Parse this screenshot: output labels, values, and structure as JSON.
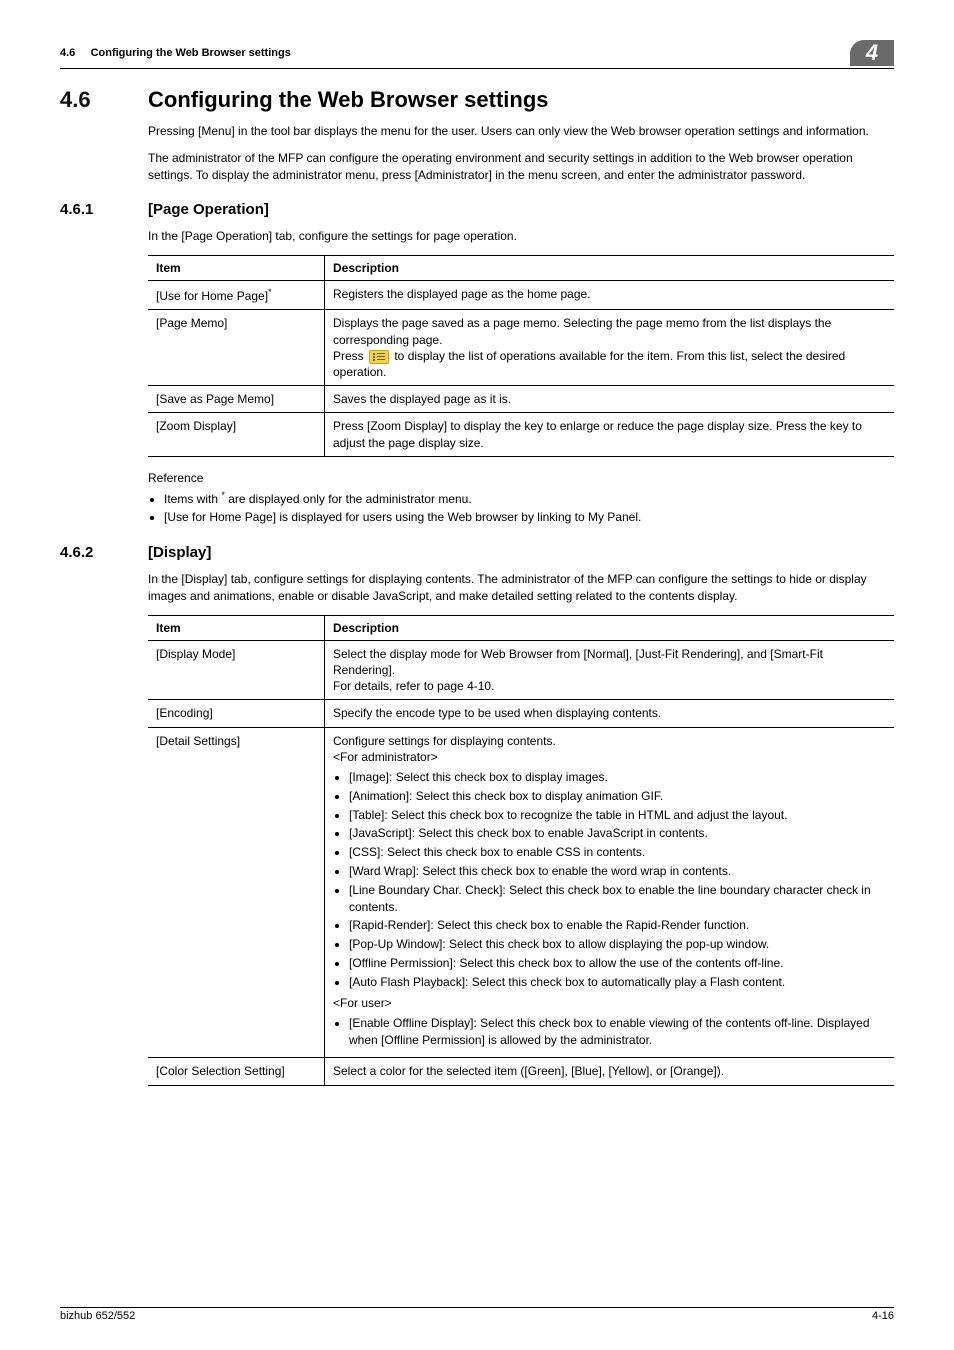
{
  "header": {
    "section_no_top": "4.6",
    "section_title_top": "Configuring the Web Browser settings",
    "badge": "4"
  },
  "sec_4_6": {
    "num": "4.6",
    "title": "Configuring the Web Browser settings",
    "para1": "Pressing [Menu] in the tool bar displays the menu for the user. Users can only view the Web browser operation settings and information.",
    "para2": "The administrator of the MFP can configure the operating environment and security settings in addition to the Web browser operation settings. To display the administrator menu, press [Administrator] in the menu screen, and enter the administrator password."
  },
  "sec_4_6_1": {
    "num": "4.6.1",
    "title": "[Page Operation]",
    "intro": "In the [Page Operation] tab, configure the settings for page operation.",
    "col_item": "Item",
    "col_desc": "Description",
    "rows": [
      {
        "item": "[Use for Home Page]",
        "star": "*",
        "desc": "Registers the displayed page as the home page."
      },
      {
        "item": "[Page Memo]",
        "desc_pre": "Displays the page saved as a page memo. Selecting the page memo from the list displays the corresponding page.\nPress ",
        "desc_post": " to display the list of operations available for the item. From this list, select the desired operation."
      },
      {
        "item": "[Save as Page Memo]",
        "desc": "Saves the displayed page as it is."
      },
      {
        "item": "[Zoom Display]",
        "desc": "Press [Zoom Display] to display the key to enlarge or reduce the page display size. Press the key to adjust the page display size."
      }
    ],
    "reference_label": "Reference",
    "ref1_pre": "Items with ",
    "ref1_star": "*",
    "ref1_post": " are displayed only for the administrator menu.",
    "ref2": "[Use for Home Page] is displayed for users using the Web browser by linking to My Panel."
  },
  "sec_4_6_2": {
    "num": "4.6.2",
    "title": "[Display]",
    "intro": "In the [Display] tab, configure settings for displaying contents. The administrator of the MFP can configure the settings to hide or display images and animations, enable or disable JavaScript, and make detailed setting related to the contents display.",
    "col_item": "Item",
    "col_desc": "Description",
    "row_display_mode": {
      "item": "[Display Mode]",
      "desc": "Select the display mode for Web Browser from [Normal], [Just-Fit Rendering], and [Smart-Fit Rendering].\nFor details, refer to page 4-10."
    },
    "row_encoding": {
      "item": "[Encoding]",
      "desc": "Specify the encode type to be used when displaying contents."
    },
    "row_detail": {
      "item": "[Detail Settings]",
      "lead": "Configure settings for displaying contents.",
      "for_admin_label": "<For administrator>",
      "for_user_label": "<For user>",
      "admin_items": [
        "[Image]: Select this check box to display images.",
        "[Animation]: Select this check box to display animation GIF.",
        "[Table]: Select this check box to recognize the table in HTML and adjust the layout.",
        "[JavaScript]: Select this check box to enable JavaScript in contents.",
        "[CSS]: Select this check box to enable CSS in contents.",
        "[Ward Wrap]: Select this check box to enable the word wrap in contents.",
        "[Line Boundary Char. Check]: Select this check box to enable the line boundary character check in contents.",
        "[Rapid-Render]: Select this check box to enable the Rapid-Render function.",
        "[Pop-Up Window]: Select this check box to allow displaying the pop-up window.",
        "[Offline Permission]: Select this check box to allow the use of the contents off-line.",
        "[Auto Flash Playback]: Select this check box to automatically play a Flash content."
      ],
      "user_items": [
        "[Enable Offline Display]: Select this check box to enable viewing of the contents off-line. Displayed when [Offline Permission] is allowed by the administrator."
      ]
    },
    "row_color": {
      "item": "[Color Selection Setting]",
      "desc": "Select a color for the selected item ([Green], [Blue], [Yellow], or [Orange])."
    }
  },
  "footer": {
    "left": "bizhub 652/552",
    "right": "4-16"
  }
}
